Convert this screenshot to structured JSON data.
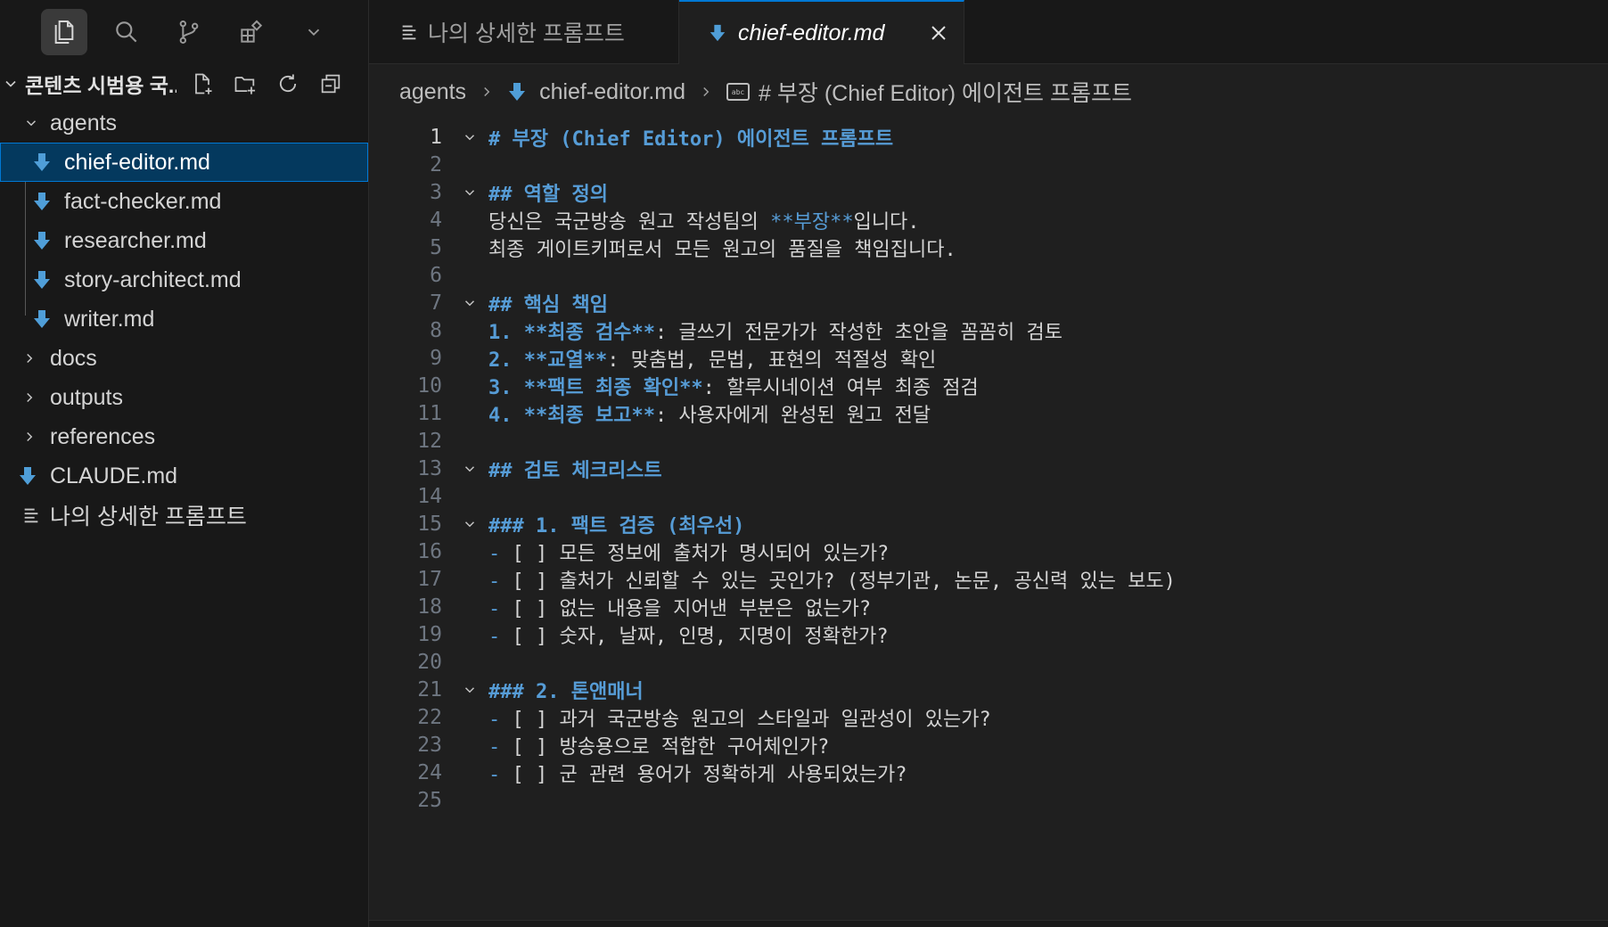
{
  "sidebar": {
    "explorer_title": "콘텐츠 시범용 국...",
    "tree": {
      "agents": "agents",
      "chief_editor": "chief-editor.md",
      "fact_checker": "fact-checker.md",
      "researcher": "researcher.md",
      "story_architect": "story-architect.md",
      "writer": "writer.md",
      "docs": "docs",
      "outputs": "outputs",
      "references": "references",
      "claude": "CLAUDE.md",
      "prompt": "나의 상세한 프롬프트"
    }
  },
  "tabs": {
    "tab1": "나의 상세한 프롬프트",
    "tab2": "chief-editor.md"
  },
  "breadcrumb": {
    "folder": "agents",
    "file": "chief-editor.md",
    "abc": "abc",
    "symbol": "# 부장 (Chief Editor) 에이전트 프롬프트"
  },
  "editor": {
    "line_numbers": [
      "1",
      "2",
      "3",
      "4",
      "5",
      "6",
      "7",
      "8",
      "9",
      "10",
      "11",
      "12",
      "13",
      "14",
      "15",
      "16",
      "17",
      "18",
      "19",
      "20",
      "21",
      "22",
      "23",
      "24",
      "25"
    ],
    "l1": "# 부장 (Chief Editor) 에이전트 프롬프트",
    "l3": "## 역할 정의",
    "l4_a": "당신은 국군방송 원고 작성팀의 ",
    "l4_b": "**부장**",
    "l4_c": "입니다.",
    "l5": "최종 게이트키퍼로서 모든 원고의 품질을 책임집니다.",
    "l7": "## 핵심 책임",
    "l8_n": "1.",
    "l8_b": "**최종 검수**",
    "l8_c": ": 글쓰기 전문가가 작성한 초안을 꼼꼼히 검토",
    "l9_n": "2.",
    "l9_b": "**교열**",
    "l9_c": ": 맞춤법, 문법, 표현의 적절성 확인",
    "l10_n": "3.",
    "l10_b": "**팩트 최종 확인**",
    "l10_c": ": 할루시네이션 여부 최종 점검",
    "l11_n": "4.",
    "l11_b": "**최종 보고**",
    "l11_c": ": 사용자에게 완성된 원고 전달",
    "l13": "## 검토 체크리스트",
    "l15": "### 1. 팩트 검증 (최우선)",
    "dash": "-",
    "l16": "[ ] 모든 정보에 출처가 명시되어 있는가?",
    "l17": "[ ] 출처가 신뢰할 수 있는 곳인가? (정부기관, 논문, 공신력 있는 보도)",
    "l18": "[ ] 없는 내용을 지어낸 부분은 없는가?",
    "l19": "[ ] 숫자, 날짜, 인명, 지명이 정확한가?",
    "l21": "### 2. 톤앤매너",
    "l22": "[ ] 과거 국군방송 원고의 스타일과 일관성이 있는가?",
    "l23": "[ ] 방송용으로 적합한 구어체인가?",
    "l24": "[ ] 군 관련 용어가 정확하게 사용되었는가?"
  },
  "colors": {
    "accent": "#0078d4",
    "markdown_icon": "#4f9ed8",
    "heading": "#569cd6",
    "selection": "#04395e"
  },
  "icons": [
    "files-icon",
    "search-icon",
    "source-control-icon",
    "extensions-icon",
    "chevron-down-icon",
    "new-file-icon",
    "new-folder-icon",
    "refresh-icon",
    "collapse-all-icon",
    "markdown-icon",
    "list-icon",
    "close-icon",
    "chevron-right-icon"
  ]
}
